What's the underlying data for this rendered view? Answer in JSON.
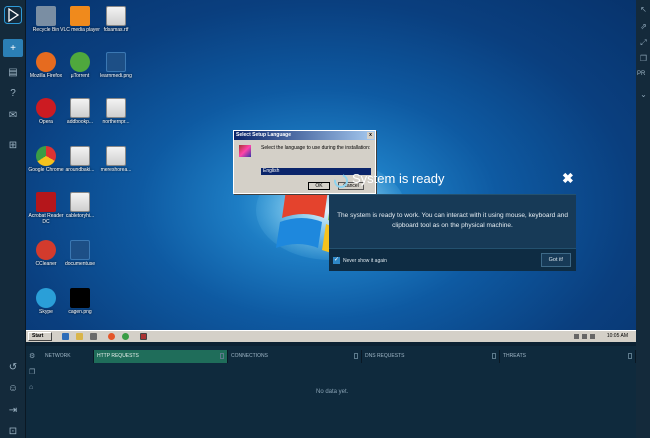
{
  "sidebar": {
    "items": [
      {
        "icon": "plus-icon",
        "glyph": "+",
        "active": true
      },
      {
        "icon": "document-icon",
        "glyph": "▤"
      },
      {
        "icon": "help-icon",
        "glyph": "?"
      },
      {
        "icon": "mail-icon",
        "glyph": "✉"
      },
      {
        "icon": "windows-icon",
        "glyph": "⊞"
      }
    ],
    "bottom_items": [
      {
        "icon": "history-icon",
        "glyph": "↺"
      },
      {
        "icon": "user-icon",
        "glyph": "☺"
      },
      {
        "icon": "logout-icon",
        "glyph": "⇥"
      },
      {
        "icon": "cart-icon",
        "glyph": "⊡"
      }
    ]
  },
  "rightbar": {
    "label": "PR"
  },
  "desktop": {
    "icons": [
      {
        "label": "Recycle Bin",
        "color": "#7a8ea3"
      },
      {
        "label": "VLC media player",
        "color": "#f08a1c"
      },
      {
        "label": "fdsamas.rtf",
        "doc": true
      },
      {
        "label": "Mozilla Firefox",
        "color": "#e66b1f"
      },
      {
        "label": "µTorrent",
        "color": "#4fa83d"
      },
      {
        "label": "learnmedi.png",
        "doc": true
      },
      {
        "label": "Opera",
        "color": "#cc1b22"
      },
      {
        "label": "addbookp...",
        "doc": true
      },
      {
        "label": "northernpr...",
        "doc": true
      },
      {
        "label": "Google Chrome",
        "color": "#3a9d45"
      },
      {
        "label": "aroundbaki...",
        "doc": true
      },
      {
        "label": "mereshorea...",
        "doc": true
      },
      {
        "label": "Acrobat Reader DC",
        "color": "#b5161b"
      },
      {
        "label": "cabletoryhi...",
        "doc": true
      },
      {
        "label": "CCleaner",
        "color": "#d33b2d"
      },
      {
        "label": "documentuse",
        "doc": true
      },
      {
        "label": "Skype",
        "color": "#2a9fd8"
      },
      {
        "label": "cagen.png",
        "color": "#000000"
      }
    ]
  },
  "setup_dialog": {
    "title": "Select Setup Language",
    "message": "Select the language to use during the installation:",
    "selected_language": "English",
    "ok_label": "OK",
    "cancel_label": "Cancel",
    "close_glyph": "x"
  },
  "ready": {
    "title": "System is ready",
    "close_glyph": "✖",
    "message": "The system is ready to work. You can interact with it using mouse, keyboard and clipboard tool as on the physical machine.",
    "checkbox_label": "Never show it again",
    "checkbox_glyph": "✓",
    "button_label": "Got it!"
  },
  "taskbar": {
    "start_label": "Start",
    "clock": "10:05 AM"
  },
  "panel": {
    "tabs": [
      {
        "label": "NETWORK"
      },
      {
        "label": "HTTP REQUESTS",
        "active": true
      },
      {
        "label": "CONNECTIONS"
      },
      {
        "label": "DNS REQUESTS"
      },
      {
        "label": "THREATS"
      }
    ],
    "empty_text": "No data yet."
  },
  "colors": {
    "accent": "#2b7fb5",
    "active_tab": "#1f6d5a",
    "panel_bg": "#0f2a3d"
  }
}
